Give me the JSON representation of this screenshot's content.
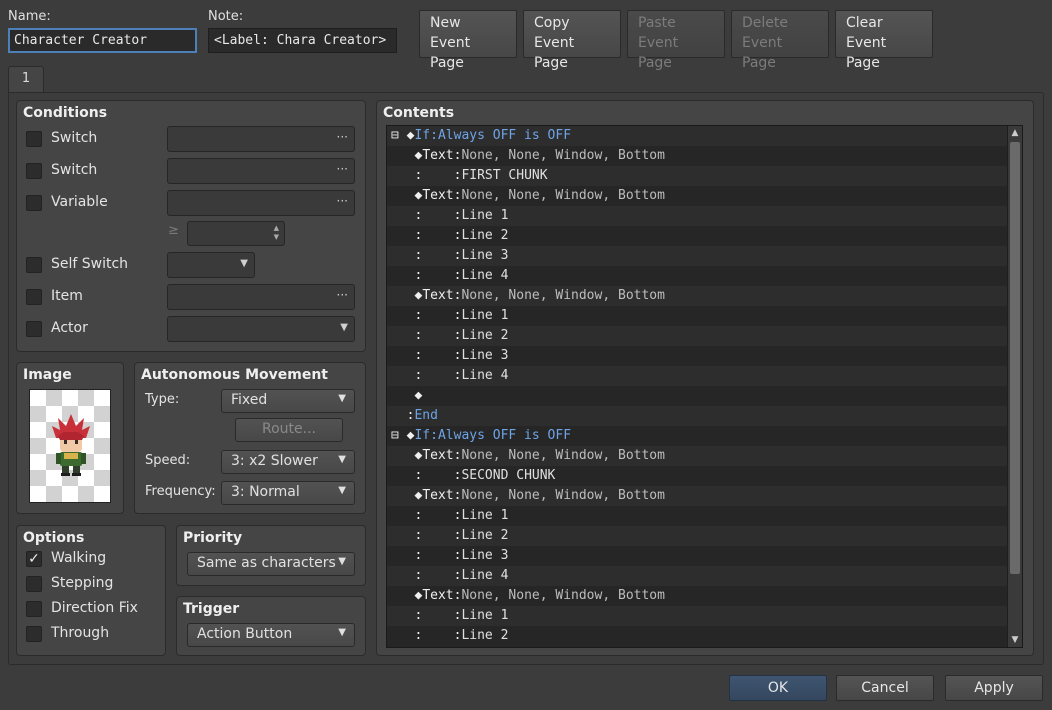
{
  "header": {
    "name_label": "Name:",
    "name_value": "Character Creator",
    "note_label": "Note:",
    "note_value": "<Label: Chara Creator>",
    "buttons": [
      {
        "line1": "New",
        "line2": "Event Page",
        "enabled": true
      },
      {
        "line1": "Copy",
        "line2": "Event Page",
        "enabled": true
      },
      {
        "line1": "Paste",
        "line2": "Event Page",
        "enabled": false
      },
      {
        "line1": "Delete",
        "line2": "Event Page",
        "enabled": false
      },
      {
        "line1": "Clear",
        "line2": "Event Page",
        "enabled": true
      }
    ]
  },
  "tabs": [
    {
      "label": "1"
    }
  ],
  "conditions": {
    "title": "Conditions",
    "items": [
      {
        "label": "Switch",
        "checked": false
      },
      {
        "label": "Switch",
        "checked": false
      },
      {
        "label": "Variable",
        "checked": false
      },
      {
        "label": "Self Switch",
        "checked": false
      },
      {
        "label": "Item",
        "checked": false
      },
      {
        "label": "Actor",
        "checked": false
      }
    ],
    "dots": "···",
    "gte": "≥"
  },
  "image": {
    "title": "Image"
  },
  "movement": {
    "title": "Autonomous Movement",
    "type_label": "Type:",
    "type_value": "Fixed",
    "route_label": "Route...",
    "speed_label": "Speed:",
    "speed_value": "3: x2 Slower",
    "frequency_label": "Frequency:",
    "frequency_value": "3: Normal"
  },
  "options": {
    "title": "Options",
    "items": [
      {
        "label": "Walking",
        "checked": true
      },
      {
        "label": "Stepping",
        "checked": false
      },
      {
        "label": "Direction Fix",
        "checked": false
      },
      {
        "label": "Through",
        "checked": false
      }
    ]
  },
  "priority": {
    "title": "Priority",
    "value": "Same as characters"
  },
  "trigger": {
    "title": "Trigger",
    "value": "Action Button"
  },
  "contents": {
    "title": "Contents",
    "rows": [
      {
        "prefix": "⊟ ◆",
        "head": "If",
        "sep": ":",
        "body": "Always OFF is OFF",
        "style": "if"
      },
      {
        "prefix": "   ◆",
        "head": "Text",
        "sep": ":",
        "body": "None, None, Window, Bottom",
        "style": "text"
      },
      {
        "prefix": "   :",
        "head": "    ",
        "sep": ":",
        "body": "FIRST CHUNK",
        "style": "line"
      },
      {
        "prefix": "   ◆",
        "head": "Text",
        "sep": ":",
        "body": "None, None, Window, Bottom",
        "style": "text"
      },
      {
        "prefix": "   :",
        "head": "    ",
        "sep": ":",
        "body": "Line 1",
        "style": "line"
      },
      {
        "prefix": "   :",
        "head": "    ",
        "sep": ":",
        "body": "Line 2",
        "style": "line"
      },
      {
        "prefix": "   :",
        "head": "    ",
        "sep": ":",
        "body": "Line 3",
        "style": "line"
      },
      {
        "prefix": "   :",
        "head": "    ",
        "sep": ":",
        "body": "Line 4",
        "style": "line"
      },
      {
        "prefix": "   ◆",
        "head": "Text",
        "sep": ":",
        "body": "None, None, Window, Bottom",
        "style": "text"
      },
      {
        "prefix": "   :",
        "head": "    ",
        "sep": ":",
        "body": "Line 1",
        "style": "line"
      },
      {
        "prefix": "   :",
        "head": "    ",
        "sep": ":",
        "body": "Line 2",
        "style": "line"
      },
      {
        "prefix": "   :",
        "head": "    ",
        "sep": ":",
        "body": "Line 3",
        "style": "line"
      },
      {
        "prefix": "   :",
        "head": "    ",
        "sep": ":",
        "body": "Line 4",
        "style": "line"
      },
      {
        "prefix": "   ◆",
        "head": "",
        "sep": "",
        "body": "",
        "style": "empty"
      },
      {
        "prefix": "  :",
        "head": "End",
        "sep": "",
        "body": "",
        "style": "end"
      },
      {
        "prefix": "⊟ ◆",
        "head": "If",
        "sep": ":",
        "body": "Always OFF is OFF",
        "style": "if"
      },
      {
        "prefix": "   ◆",
        "head": "Text",
        "sep": ":",
        "body": "None, None, Window, Bottom",
        "style": "text"
      },
      {
        "prefix": "   :",
        "head": "    ",
        "sep": ":",
        "body": "SECOND CHUNK",
        "style": "line"
      },
      {
        "prefix": "   ◆",
        "head": "Text",
        "sep": ":",
        "body": "None, None, Window, Bottom",
        "style": "text"
      },
      {
        "prefix": "   :",
        "head": "    ",
        "sep": ":",
        "body": "Line 1",
        "style": "line"
      },
      {
        "prefix": "   :",
        "head": "    ",
        "sep": ":",
        "body": "Line 2",
        "style": "line"
      },
      {
        "prefix": "   :",
        "head": "    ",
        "sep": ":",
        "body": "Line 3",
        "style": "line"
      },
      {
        "prefix": "   :",
        "head": "    ",
        "sep": ":",
        "body": "Line 4",
        "style": "line"
      },
      {
        "prefix": "   ◆",
        "head": "Text",
        "sep": ":",
        "body": "None, None, Window, Bottom",
        "style": "text"
      },
      {
        "prefix": "   :",
        "head": "    ",
        "sep": ":",
        "body": "Line 1",
        "style": "line"
      },
      {
        "prefix": "   :",
        "head": "    ",
        "sep": ":",
        "body": "Line 2",
        "style": "line"
      }
    ]
  },
  "footer": {
    "ok": "OK",
    "cancel": "Cancel",
    "apply": "Apply"
  },
  "colors": {
    "accent": "#4d7fb8",
    "command_blue": "#6ea4e6",
    "background": "#3c3c3c"
  }
}
